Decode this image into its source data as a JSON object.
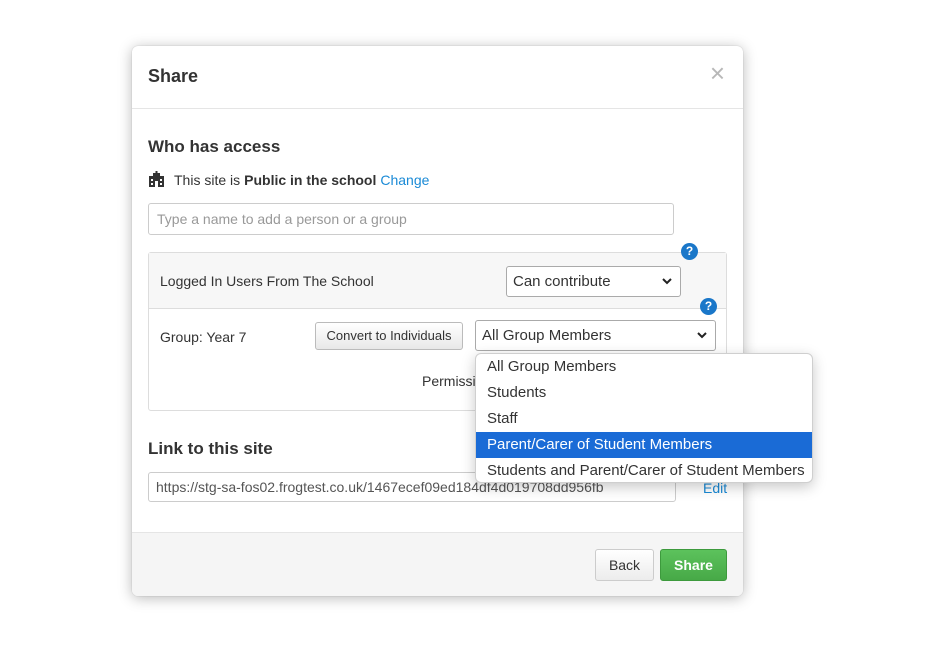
{
  "modal": {
    "title": "Share",
    "close_glyph": "×"
  },
  "access": {
    "heading": "Who has access",
    "public_prefix": "This site is",
    "public_bold": "Public in the school",
    "change_link": "Change",
    "icon": "school-building-icon",
    "name_placeholder": "Type a name to add a person or a group"
  },
  "permissions": {
    "help_glyph": "?",
    "row1": {
      "label": "Logged In Users From The School",
      "select_value": "Can contribute"
    },
    "row2": {
      "label": "Group: Year 7",
      "convert_button": "Convert to Individuals",
      "select_value": "All Group Members",
      "permissions_text": "Permissi"
    }
  },
  "dropdown": {
    "options": [
      "All Group Members",
      "Students",
      "Staff",
      "Parent/Carer of Student Members",
      "Students and Parent/Carer of Student Members"
    ],
    "highlighted": "Parent/Carer of Student Members",
    "highlight_color": "#1a6bd6"
  },
  "link": {
    "heading": "Link to this site",
    "url": "https://stg-sa-fos02.frogtest.co.uk/1467ecef09ed184df4d019708dd956fb",
    "edit_link": "Edit"
  },
  "footer": {
    "back_label": "Back",
    "share_label": "Share"
  },
  "colors": {
    "link_blue": "#1a8ad6",
    "help_blue": "#1a77c9",
    "share_green": "#4cb04c"
  }
}
